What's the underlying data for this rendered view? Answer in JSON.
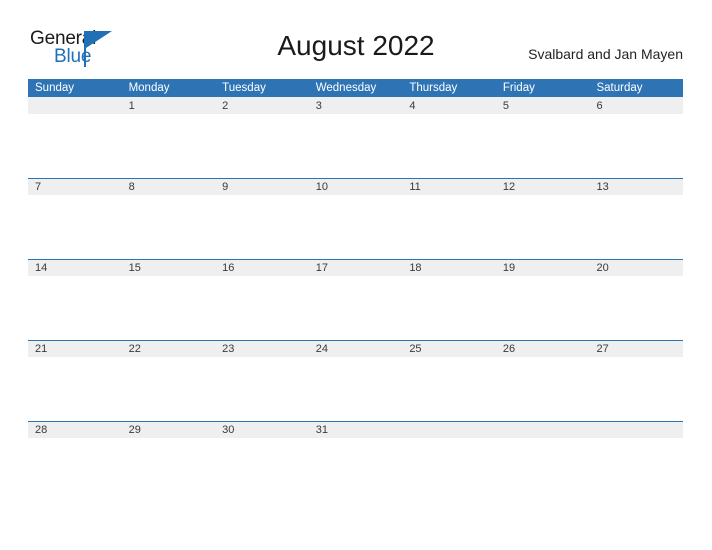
{
  "logo": {
    "text_top": "General",
    "text_bottom": "Blue",
    "color_dark": "#1b1b1b",
    "color_blue": "#2070b8",
    "flag_icon": "flag-triangle-icon"
  },
  "header": {
    "title": "August 2022",
    "region": "Svalbard and Jan Mayen"
  },
  "colors": {
    "header_blue": "#2e74b5",
    "date_band_gray": "#efefef",
    "date_text": "#3a3a3a",
    "weekday_text": "#ffffff"
  },
  "calendar": {
    "month": "August",
    "year": "2022",
    "weekdays": [
      "Sunday",
      "Monday",
      "Tuesday",
      "Wednesday",
      "Thursday",
      "Friday",
      "Saturday"
    ],
    "weeks": [
      [
        "",
        "1",
        "2",
        "3",
        "4",
        "5",
        "6"
      ],
      [
        "7",
        "8",
        "9",
        "10",
        "11",
        "12",
        "13"
      ],
      [
        "14",
        "15",
        "16",
        "17",
        "18",
        "19",
        "20"
      ],
      [
        "21",
        "22",
        "23",
        "24",
        "25",
        "26",
        "27"
      ],
      [
        "28",
        "29",
        "30",
        "31",
        "",
        "",
        ""
      ]
    ]
  }
}
